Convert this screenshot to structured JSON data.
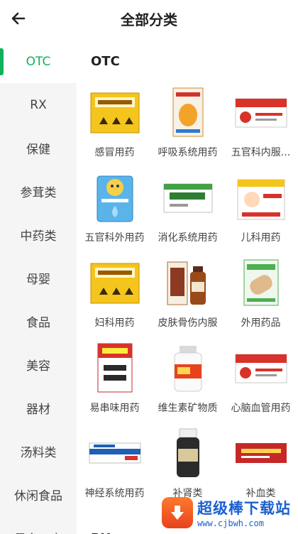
{
  "header": {
    "title": "全部分类",
    "back_icon": "arrow-left-icon"
  },
  "sidebar": {
    "accent_color": "#0fb25a",
    "items": [
      {
        "label": "OTC",
        "active": true
      },
      {
        "label": "RX",
        "active": false
      },
      {
        "label": "保健",
        "active": false
      },
      {
        "label": "参茸类",
        "active": false
      },
      {
        "label": "中药类",
        "active": false
      },
      {
        "label": "母婴",
        "active": false
      },
      {
        "label": "食品",
        "active": false
      },
      {
        "label": "美容",
        "active": false
      },
      {
        "label": "器材",
        "active": false
      },
      {
        "label": "汤料类",
        "active": false
      },
      {
        "label": "休闲食品",
        "active": false
      },
      {
        "label": "最多五字",
        "active": false
      }
    ]
  },
  "main": {
    "sections": [
      {
        "title": "OTC",
        "items": [
          {
            "label": "感冒用药",
            "thumb": "yellow-box"
          },
          {
            "label": "呼吸系统用药",
            "thumb": "orange-box"
          },
          {
            "label": "五官科内服...",
            "thumb": "white-red-box"
          },
          {
            "label": "五官科外用药",
            "thumb": "blue-bag"
          },
          {
            "label": "消化系统用药",
            "thumb": "green-white-box"
          },
          {
            "label": "儿科用药",
            "thumb": "baby-box"
          },
          {
            "label": "妇科用药",
            "thumb": "yellow-box"
          },
          {
            "label": "皮肤骨伤内服",
            "thumb": "bottle-box"
          },
          {
            "label": "外用药品",
            "thumb": "plaster-box"
          },
          {
            "label": "易串味用药",
            "thumb": "red-tall-box"
          },
          {
            "label": "维生素矿物质",
            "thumb": "white-bottle"
          },
          {
            "label": "心脑血管用药",
            "thumb": "white-red-box"
          },
          {
            "label": "神经系统用药",
            "thumb": "blue-strip-box"
          },
          {
            "label": "补肾类",
            "thumb": "dark-bottle"
          },
          {
            "label": "补血类",
            "thumb": "red-long-box"
          }
        ]
      },
      {
        "title": "RX",
        "items": []
      }
    ]
  },
  "watermark": {
    "title": "超级棒下载站",
    "url": "www.cjbwh.com"
  }
}
